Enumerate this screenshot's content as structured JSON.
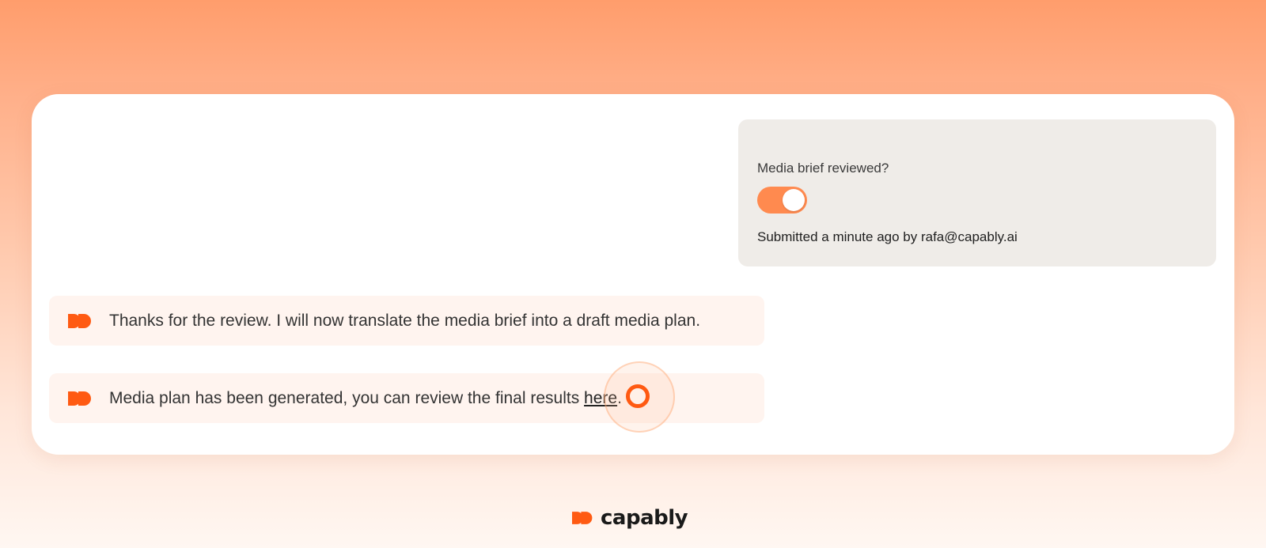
{
  "review": {
    "question": "Media brief reviewed?",
    "toggle_on": true,
    "meta": "Submitted a minute ago by rafa@capably.ai"
  },
  "messages": [
    {
      "text": "Thanks for the review. I will now translate the media brief into a draft media plan."
    },
    {
      "text_before": "Media plan has been generated, you can review the final results ",
      "link_text": "here",
      "text_after": "."
    }
  ],
  "footer": {
    "brand": "capably"
  },
  "colors": {
    "accent": "#ff5a12",
    "toggle": "#ff8a4f",
    "message_bg": "#fff4ef",
    "panel_bg": "#efece8"
  },
  "icons": {
    "bot": "double-chevron-logo-icon",
    "brand": "capably-logo-icon"
  }
}
